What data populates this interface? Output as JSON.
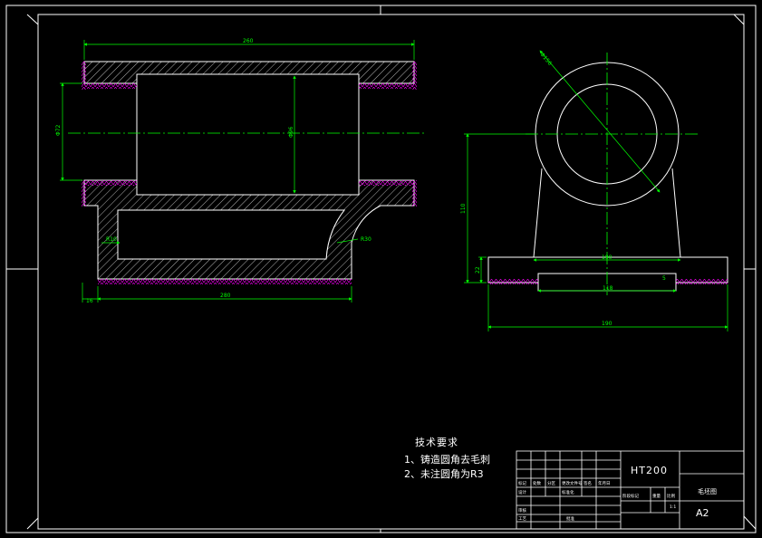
{
  "colors": {
    "background": "#000000",
    "outline": "#ffffff",
    "dimension": "#00ff00",
    "centerline": "#00ff00",
    "hatch": "#ffffff",
    "surface_mark": "#ff00ff"
  },
  "dimensions": {
    "overall_length": "260",
    "bore_diameter": "Φ72",
    "inner_diameter": "Φ96",
    "base_length": "280",
    "left_offset": "16",
    "fillet_left": "R10",
    "fillet_right": "R30",
    "circle_diameter": "Φ156",
    "center_height": "110",
    "base_height": "22",
    "base_top_width": "190",
    "slot_width": "118",
    "overall_width": "190",
    "slot_depth": "5"
  },
  "technical_requirements": {
    "title": "技术要求",
    "items": [
      "1、铸造圆角去毛刺",
      "2、未注圆角为R3"
    ]
  },
  "title_block": {
    "material": "HT200",
    "drawing_name": "毛坯图",
    "sheet_size": "A2",
    "scale": "1:1",
    "label_marks": "标记",
    "label_count": "处数",
    "label_zone": "分区",
    "label_change_doc": "更改文件号",
    "label_signature": "签名",
    "label_date": "年月日",
    "label_design": "设计",
    "label_standard": "标准化",
    "label_stage": "阶段标记",
    "label_weight": "重量",
    "label_ratio": "比例",
    "label_review": "审核",
    "label_process": "工艺",
    "label_approve": "批准"
  }
}
